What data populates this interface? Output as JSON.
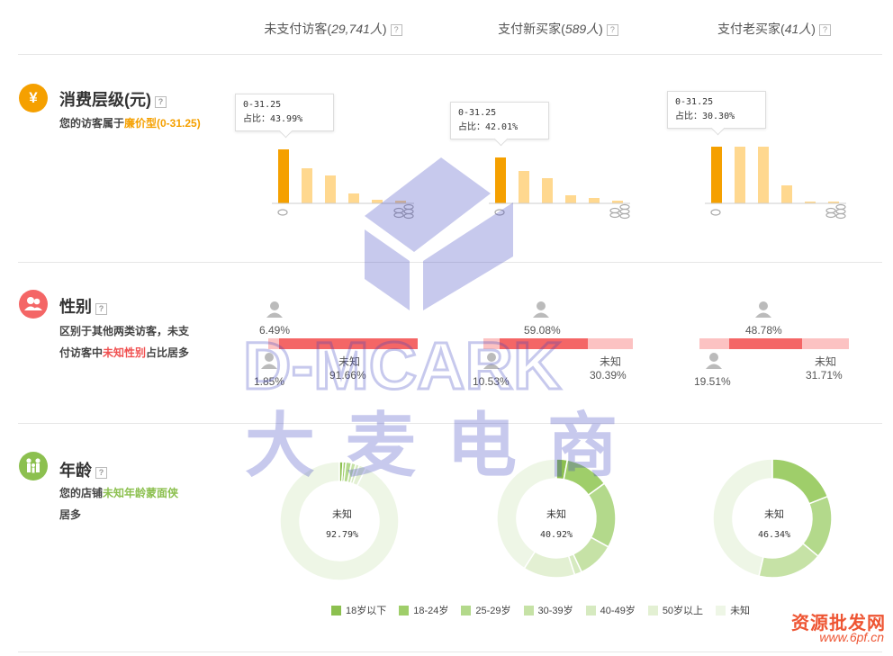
{
  "columns": [
    {
      "label": "未支付访客",
      "count": "29,741人"
    },
    {
      "label": "支付新买家",
      "count": "589人"
    },
    {
      "label": "支付老买家",
      "count": "41人"
    }
  ],
  "help_icon": "?",
  "consumption": {
    "icon": "¥",
    "title": "消费层级(元)",
    "desc_prefix": "您的访客属于",
    "desc_highlight": "廉价型(0-31.25)",
    "tooltips": [
      {
        "range": "0-31.25",
        "share": "占比：43.99%"
      },
      {
        "range": "0-31.25",
        "share": "占比：42.01%"
      },
      {
        "range": "0-31.25",
        "share": "占比：30.30%"
      }
    ]
  },
  "gender": {
    "icon": "person-pair-icon",
    "title": "性别",
    "desc_prefix": "区别于其他两类访客，未支付访客中",
    "desc_highlight": "未知性别",
    "desc_suffix": "占比居多",
    "unknown_label": "未知",
    "columns": [
      {
        "top": "6.49%",
        "bottom_left": "1.85%",
        "bottom_right": "91.66%",
        "highlight": "unknown"
      },
      {
        "top": "59.08%",
        "bottom_left": "10.53%",
        "bottom_right": "30.39%",
        "highlight": "female"
      },
      {
        "top": "48.78%",
        "bottom_left": "19.51%",
        "bottom_right": "31.71%",
        "highlight": "female"
      }
    ]
  },
  "age": {
    "icon": "family-icon",
    "title": "年龄",
    "desc_prefix": "您的店铺",
    "desc_highlight": "未知年龄蒙面侠",
    "desc_suffix": "居多",
    "donuts": [
      {
        "label": "未知",
        "value": "92.79%",
        "segments": [
          1.0,
          0.8,
          1.5,
          1.2,
          1.0,
          1.9,
          92.79
        ]
      },
      {
        "label": "未知",
        "value": "40.92%",
        "segments": [
          3.0,
          12.0,
          18.0,
          10.0,
          2.0,
          14.08,
          40.92
        ]
      },
      {
        "label": "未知",
        "value": "46.34%",
        "segments": [
          0.0,
          19.0,
          17.0,
          17.66,
          0.0,
          0.0,
          46.34
        ]
      }
    ],
    "legend": [
      {
        "label": "18岁以下",
        "color": "#8cc04f"
      },
      {
        "label": "18-24岁",
        "color": "#9fce6a"
      },
      {
        "label": "25-29岁",
        "color": "#b3d98b"
      },
      {
        "label": "30-39岁",
        "color": "#c6e2a6"
      },
      {
        "label": "40-49岁",
        "color": "#d6eac0"
      },
      {
        "label": "50岁以上",
        "color": "#e3f0d3"
      },
      {
        "label": "未知",
        "color": "#eef6e6"
      }
    ]
  },
  "colors": {
    "orange": "#f5a000",
    "orange_light": "#ffd88f",
    "red": "#f46666",
    "pink": "#fcc2c2",
    "green": "#8cc04f"
  },
  "watermark": {
    "line1": "D-MCARK",
    "line2": "大麦电商"
  },
  "corner": {
    "line1": "资源批发网",
    "line2": "www.6pf.cn"
  }
}
